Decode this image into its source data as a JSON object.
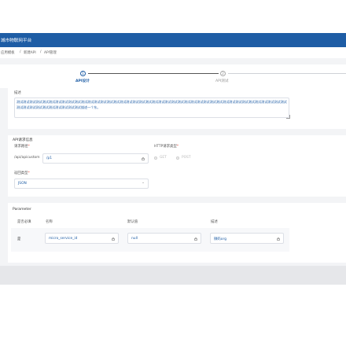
{
  "header": {
    "title": "城市物联网平台"
  },
  "breadcrumb": [
    "应用模板",
    "新建API",
    "API管理"
  ],
  "breadcrumb_sep": "/",
  "steps": [
    {
      "index": "1",
      "label": "API设计"
    },
    {
      "index": "2",
      "label": "API测试"
    }
  ],
  "description": {
    "label": "描述",
    "value": "测试测试测试测试测试测试测试测试测试测试测试测试测试测试测试测试测试测试测试测试测试测试测试测试测试测试测试测试测试测试测试测试测试测试测试测试测试测试测试测试测试测试测试测试测试测试测试测试测试测试测试测试描述一个东。"
  },
  "api_request": {
    "section_title": "API请求信息",
    "path_label": "请求路径",
    "path_prefix": "/api/apicustom",
    "path_value": "/p1",
    "method_label": "HTTP请求类型",
    "methods": [
      "GET",
      "POST"
    ],
    "return_label": "返回类型",
    "return_value": "JSON"
  },
  "parameter": {
    "section_title": "Parameter",
    "columns": [
      "是否必填",
      "名称",
      "默认值",
      "描述"
    ],
    "rows": [
      {
        "required": "是",
        "name": "micro_service_id",
        "default": "null",
        "desc": "微码org"
      }
    ]
  },
  "colors": {
    "primary": "#1e5da5",
    "background": "#f3f4f6"
  },
  "icons": [
    "lock-icon",
    "chevron-down-icon",
    "resize-handle-icon"
  ]
}
